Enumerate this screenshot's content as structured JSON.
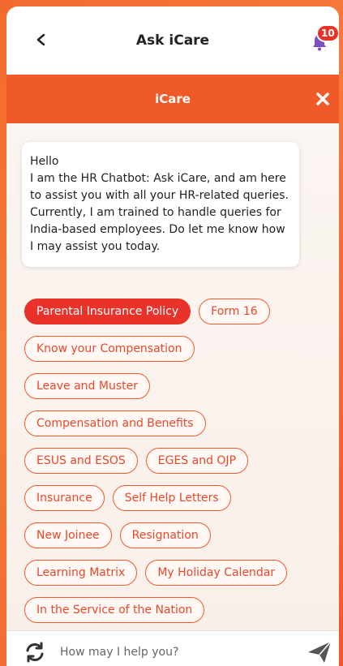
{
  "header": {
    "title": "Ask iCare",
    "notification_count": "10"
  },
  "chat": {
    "title": "iCare"
  },
  "bot_message": {
    "greeting": "Hello",
    "body": "I am the HR Chatbot: Ask iCare, and am here to assist you with all your HR-related queries. Currently, I am trained to handle queries for India-based employees. Do let me know how I may assist you today."
  },
  "chips": [
    [
      "Parental Insurance Policy",
      "Form 16"
    ],
    [
      "Know your Compensation"
    ],
    [
      "Leave and Muster"
    ],
    [
      "Compensation and Benefits"
    ],
    [
      "ESUS and ESOS",
      "EGES and OJP"
    ],
    [
      "Insurance",
      "Self Help Letters"
    ],
    [
      "New Joinee",
      "Resignation"
    ],
    [
      "Learning Matrix",
      "My Holiday Calendar"
    ],
    [
      "In the Service of the Nation"
    ]
  ],
  "input": {
    "placeholder": "How may I help you?"
  },
  "colors": {
    "accent": "#f05a28",
    "active_chip": "#e8322a"
  }
}
